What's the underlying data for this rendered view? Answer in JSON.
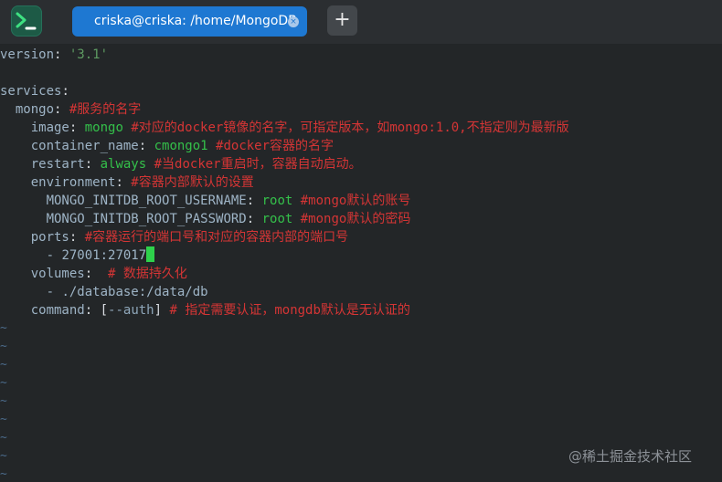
{
  "titlebar": {
    "app_icon": "terminal-icon",
    "tab_title": "criska@criska: /home/MongoDB",
    "tab_close_glyph": "×",
    "new_tab_glyph": "+",
    "accent": "#1e78d2"
  },
  "editor": {
    "l1": {
      "key": "version",
      "colon": ": ",
      "value": "'3.1'"
    },
    "l3": {
      "key": "services",
      "colon": ":"
    },
    "l4": {
      "indent": "  ",
      "key": "mongo",
      "colon": ": ",
      "comment": "#服务的名字"
    },
    "l5": {
      "indent": "    ",
      "key": "image",
      "colon": ": ",
      "value": "mongo",
      "comment": " #对应的docker镜像的名字，可指定版本，如mongo:1.0,不指定则为最新版"
    },
    "l6": {
      "indent": "    ",
      "key": "container_name",
      "colon": ": ",
      "value": "cmongo1",
      "comment": " #docker容器的名字"
    },
    "l7": {
      "indent": "    ",
      "key": "restart",
      "colon": ": ",
      "value": "always",
      "comment": " #当docker重启时，容器自动启动。"
    },
    "l8": {
      "indent": "    ",
      "key": "environment",
      "colon": ": ",
      "comment": "#容器内部默认的设置"
    },
    "l9": {
      "indent": "      ",
      "key": "MONGO_INITDB_ROOT_USERNAME",
      "colon": ": ",
      "value": "root",
      "comment": " #mongo默认的账号"
    },
    "l10": {
      "indent": "      ",
      "key": "MONGO_INITDB_ROOT_PASSWORD",
      "colon": ": ",
      "value": "root",
      "comment": " #mongo默认的密码"
    },
    "l11": {
      "indent": "    ",
      "key": "ports",
      "colon": ": ",
      "comment": "#容器运行的端口号和对应的容器内部的端口号"
    },
    "l12": {
      "indent": "      ",
      "dash": "- ",
      "value": "27001:27017"
    },
    "l13": {
      "indent": "    ",
      "key": "volumes",
      "colon": ":  ",
      "comment": "# 数据持久化"
    },
    "l14": {
      "indent": "      ",
      "dash": "- ",
      "value": "./database:/data/db"
    },
    "l15": {
      "indent": "    ",
      "key": "command",
      "colon": ": ",
      "open": "[",
      "flag": "--auth",
      "close": "]",
      "comment": " # 指定需要认证，mongdb默认是无认证的"
    },
    "empty_line_marker": "~"
  },
  "watermark": "@稀土掘金技术社区",
  "colors": {
    "background": "#232628",
    "key": "#9eb4c6",
    "value": "#34c04a",
    "comment": "#d53535",
    "tilde": "#4b6b8a",
    "cursor": "#2ed14b"
  }
}
